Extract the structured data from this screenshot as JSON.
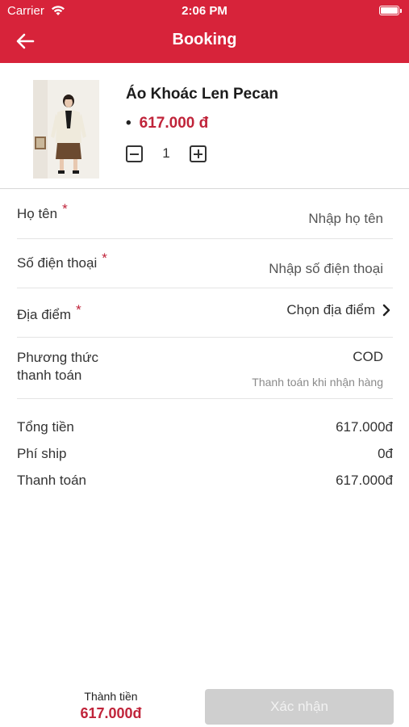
{
  "status_bar": {
    "carrier": "Carrier",
    "time": "2:06 PM"
  },
  "header": {
    "title": "Booking"
  },
  "product": {
    "name": "Áo Khoác Len Pecan",
    "bullet": "•",
    "price": "617.000 đ",
    "quantity": "1"
  },
  "form": {
    "name_label": "Họ tên",
    "name_placeholder": "Nhập họ tên",
    "phone_label": "Số điện thoại",
    "phone_placeholder": "Nhập số điện thoại",
    "location_label": "Địa điểm",
    "location_value": "Chọn địa điểm",
    "required_mark": "*",
    "payment_label_line1": "Phương thức",
    "payment_label_line2": "thanh toán",
    "payment_value": "COD",
    "payment_note": "Thanh toán khi nhận hàng"
  },
  "summary": {
    "subtotal_label": "Tổng tiền",
    "subtotal_value": "617.000đ",
    "shipping_label": "Phí ship",
    "shipping_value": "0đ",
    "total_label": "Thanh toán",
    "total_value": "617.000đ"
  },
  "footer": {
    "total_label": "Thành tiền",
    "total_value": "617.000đ",
    "confirm_label": "Xác nhận"
  },
  "colors": {
    "brand_red": "#d7233a",
    "price_red": "#c0243a",
    "disabled_button": "#cfcfcf"
  },
  "icons": [
    "wifi-icon",
    "battery-icon",
    "back-arrow-icon",
    "minus-icon",
    "plus-icon",
    "chevron-right-icon"
  ]
}
